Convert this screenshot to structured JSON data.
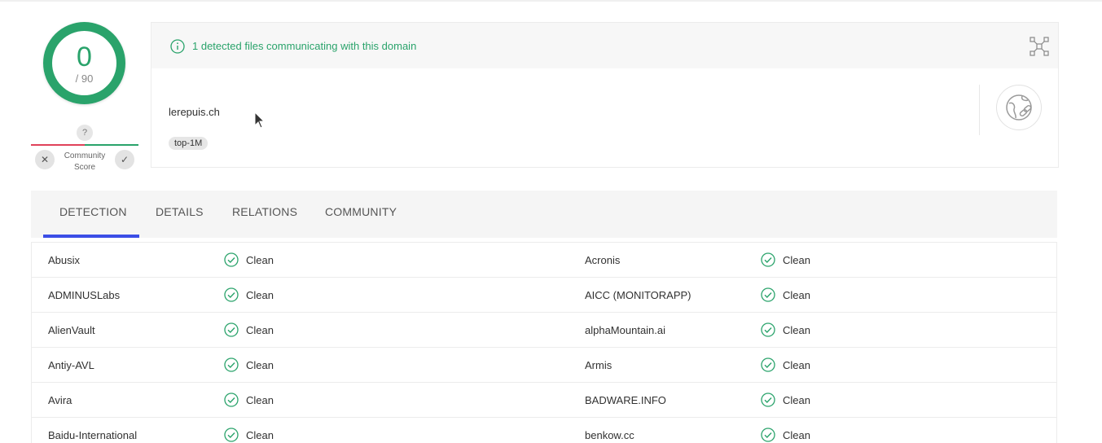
{
  "score": {
    "detections": "0",
    "total": "/ 90",
    "ring_color": "#2aa36b",
    "question_mark": "?",
    "community_label_line1": "Community",
    "community_label_line2": "Score",
    "downvote_icon": "close-icon",
    "upvote_icon": "check-icon"
  },
  "info": {
    "header_text": "1 detected files communicating with this domain",
    "header_icon": "info-circle-icon",
    "graph_icon": "graph-expand-icon",
    "domain": "lerepuis.ch",
    "tag": "top-1M",
    "domain_icon": "globe-link-icon"
  },
  "tabs": [
    {
      "label": "DETECTION",
      "active": true
    },
    {
      "label": "DETAILS",
      "active": false
    },
    {
      "label": "RELATIONS",
      "active": false
    },
    {
      "label": "COMMUNITY",
      "active": false
    }
  ],
  "accent_color": "#3b4ee6",
  "clean_color": "#2aa36b",
  "detections": [
    {
      "left_engine": "Abusix",
      "left_result": "Clean",
      "right_engine": "Acronis",
      "right_result": "Clean"
    },
    {
      "left_engine": "ADMINUSLabs",
      "left_result": "Clean",
      "right_engine": "AICC (MONITORAPP)",
      "right_result": "Clean"
    },
    {
      "left_engine": "AlienVault",
      "left_result": "Clean",
      "right_engine": "alphaMountain.ai",
      "right_result": "Clean"
    },
    {
      "left_engine": "Antiy-AVL",
      "left_result": "Clean",
      "right_engine": "Armis",
      "right_result": "Clean"
    },
    {
      "left_engine": "Avira",
      "left_result": "Clean",
      "right_engine": "BADWARE.INFO",
      "right_result": "Clean"
    },
    {
      "left_engine": "Baidu-International",
      "left_result": "Clean",
      "right_engine": "benkow.cc",
      "right_result": "Clean"
    }
  ]
}
